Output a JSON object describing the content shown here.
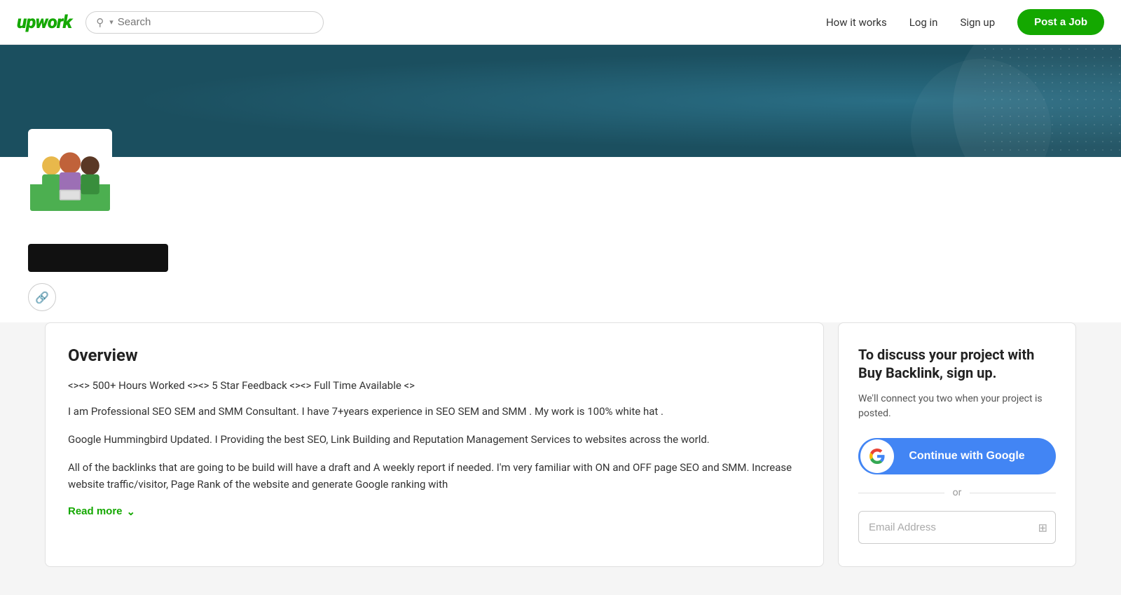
{
  "nav": {
    "logo": "upwork",
    "search_placeholder": "Search",
    "links": [
      {
        "label": "How it works",
        "id": "how-it-works"
      },
      {
        "label": "Log in",
        "id": "login"
      },
      {
        "label": "Sign up",
        "id": "signup"
      }
    ],
    "post_job_label": "Post a Job"
  },
  "profile": {
    "link_icon": "🔗",
    "name_redacted": true
  },
  "overview": {
    "title": "Overview",
    "tagline": "<><> 500+ Hours Worked <><> 5 Star Feedback <><> Full Time Available <>",
    "paragraphs": [
      "I am Professional SEO SEM and SMM Consultant. I have 7+years experience in SEO SEM and SMM . My work is 100% white hat .",
      "Google Hummingbird Updated. I Providing the best SEO, Link Building and Reputation Management Services to websites across the world.",
      "All of the backlinks that are going to be build will have a draft and A weekly report if needed. I'm very familiar with ON and OFF page SEO and SMM. Increase website traffic/visitor, Page Rank of the website and generate Google ranking with"
    ],
    "read_more_label": "Read more"
  },
  "signup_card": {
    "title": "To discuss your project with Buy Backlink, sign up.",
    "subtitle": "We'll connect you two when your project is posted.",
    "google_button_label": "Continue with Google",
    "or_label": "or",
    "email_placeholder": "Email Address"
  }
}
